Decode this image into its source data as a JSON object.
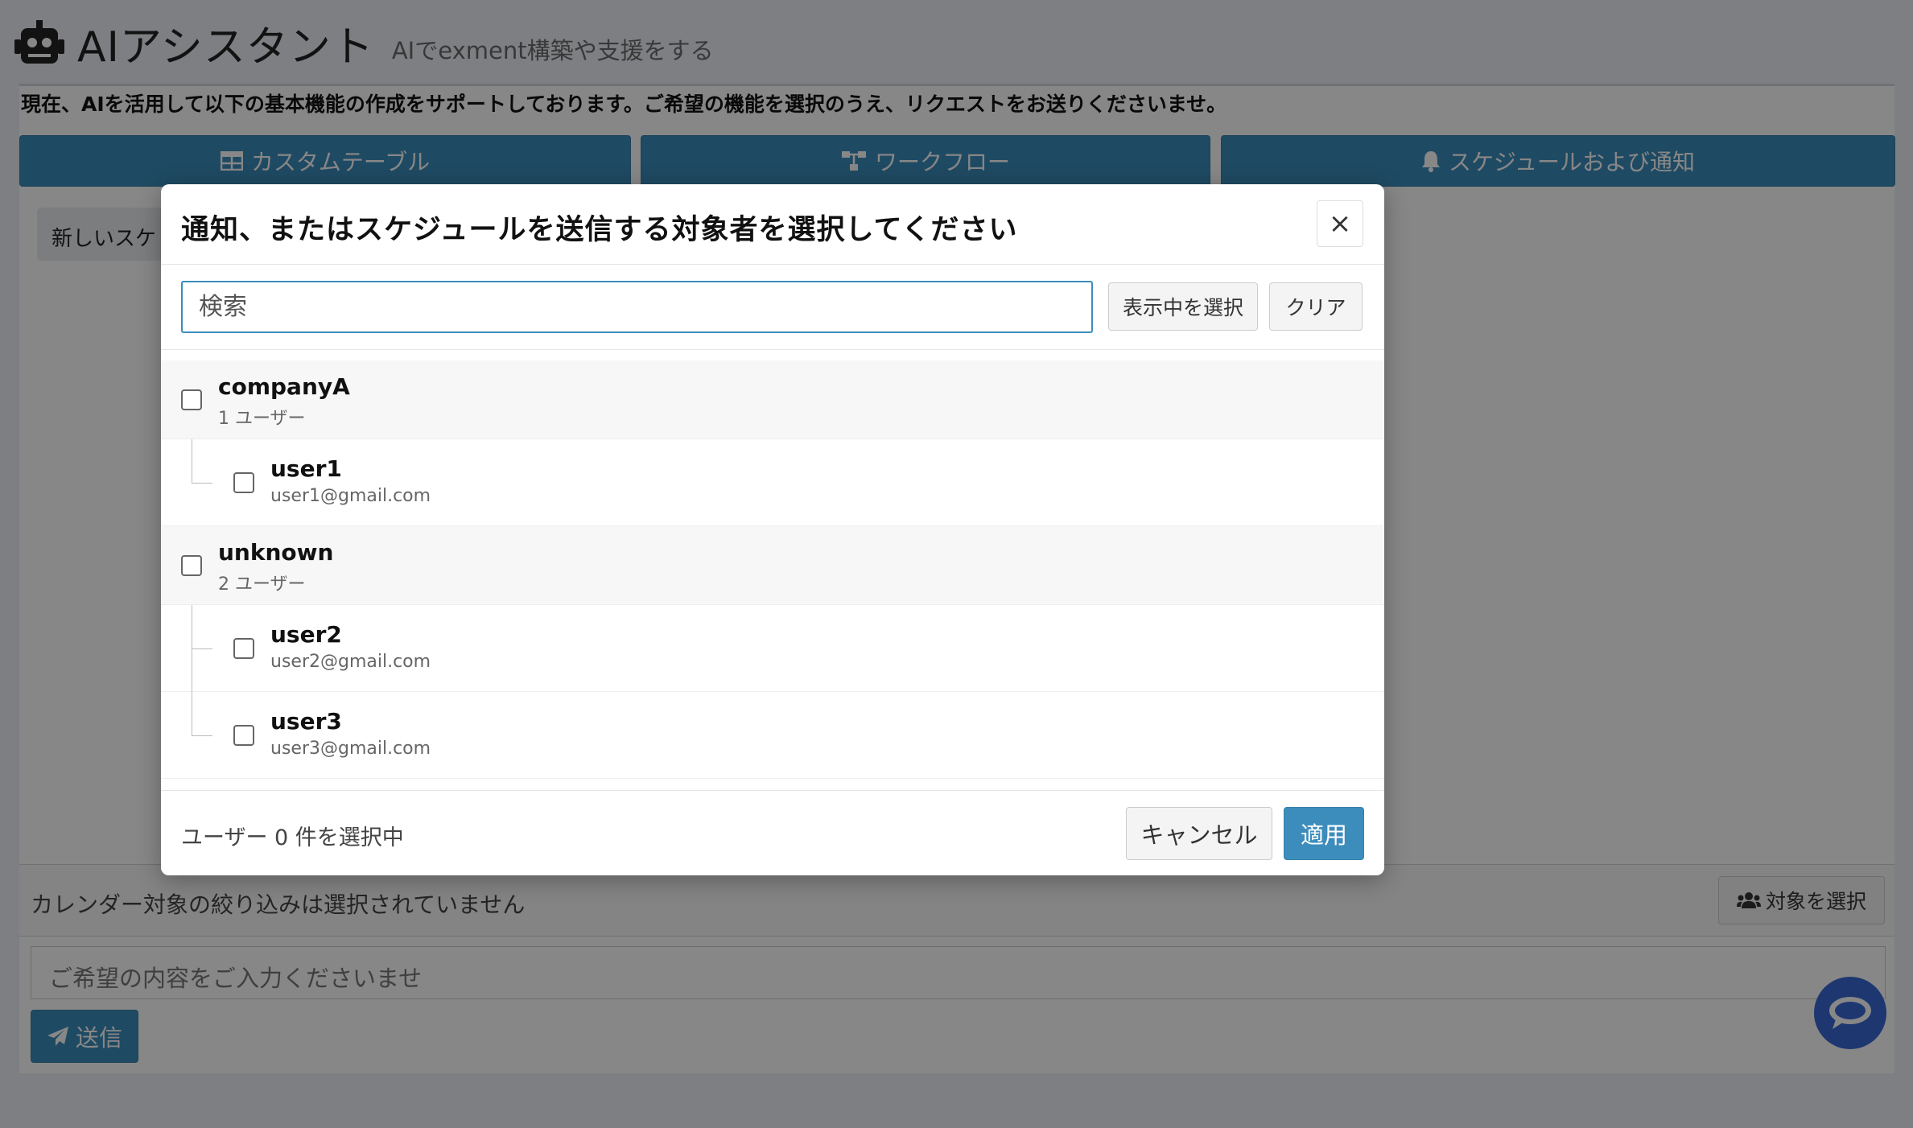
{
  "page": {
    "title": "AIアシスタント",
    "subtitle": "AIでexment構築や支援をする",
    "intro": "現在、AIを活用して以下の基本機能の作成をサポートしております。ご希望の機能を選択のうえ、リクエストをお送りくださいませ。"
  },
  "tabs": [
    {
      "label": "カスタムテーブル",
      "icon": "table-icon"
    },
    {
      "label": "ワークフロー",
      "icon": "sitemap-icon"
    },
    {
      "label": "スケジュールおよび通知",
      "icon": "bell-icon"
    }
  ],
  "chat": {
    "message_preview": "新しいスケ"
  },
  "filter": {
    "status_text": "カレンダー対象の絞り込みは選択されていません",
    "select_target_label": "対象を選択"
  },
  "request": {
    "placeholder": "ご希望の内容をご入力くださいませ",
    "send_label": "送信"
  },
  "modal": {
    "title": "通知、またはスケジュールを送信する対象者を選択してください",
    "close_label": "×",
    "search_placeholder": "検索",
    "select_visible_label": "表示中を選択",
    "clear_label": "クリア",
    "groups": [
      {
        "name": "companyA",
        "count_text": "1 ユーザー",
        "users": [
          {
            "name": "user1",
            "email": "user1@gmail.com"
          }
        ]
      },
      {
        "name": "unknown",
        "count_text": "2 ユーザー",
        "users": [
          {
            "name": "user2",
            "email": "user2@gmail.com"
          },
          {
            "name": "user3",
            "email": "user3@gmail.com"
          }
        ]
      }
    ],
    "selected_count_text": "ユーザー 0 件を選択中",
    "cancel_label": "キャンセル",
    "apply_label": "適用"
  },
  "colors": {
    "primary": "#3c8dbc",
    "fab": "#3a68d6",
    "overlay": "rgba(0,0,0,0.47)"
  }
}
